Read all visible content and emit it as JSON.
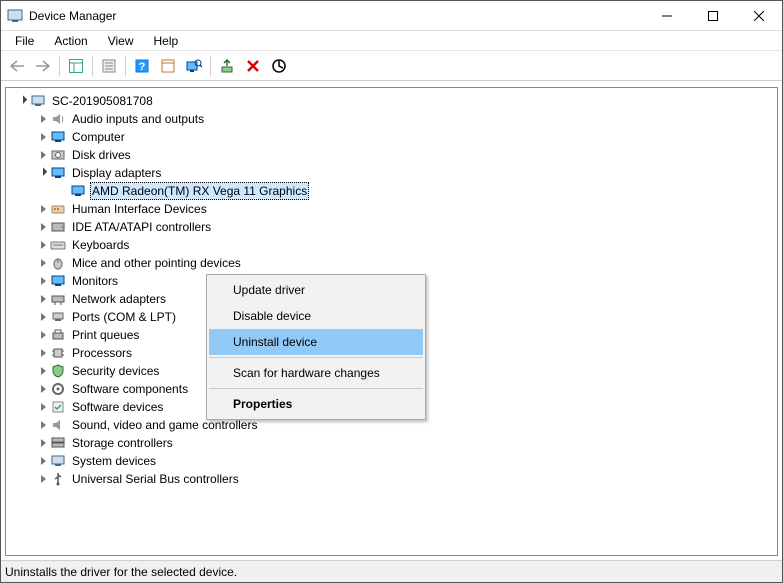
{
  "window": {
    "title": "Device Manager",
    "status": "Uninstalls the driver for the selected device."
  },
  "menu": {
    "file": "File",
    "action": "Action",
    "view": "View",
    "help": "Help"
  },
  "root": {
    "name": "SC-201905081708"
  },
  "categories": {
    "audio": "Audio inputs and outputs",
    "computer": "Computer",
    "disk": "Disk drives",
    "display": "Display adapters",
    "hid": "Human Interface Devices",
    "ide": "IDE ATA/ATAPI controllers",
    "keyboards": "Keyboards",
    "mice": "Mice and other pointing devices",
    "monitors": "Monitors",
    "network": "Network adapters",
    "ports": "Ports (COM & LPT)",
    "printq": "Print queues",
    "processors": "Processors",
    "security": "Security devices",
    "swcomp": "Software components",
    "swdev": "Software devices",
    "sound": "Sound, video and game controllers",
    "storage": "Storage controllers",
    "system": "System devices",
    "usb": "Universal Serial Bus controllers"
  },
  "selected_device": "AMD Radeon(TM) RX Vega 11 Graphics",
  "context_menu": {
    "update": "Update driver",
    "disable": "Disable device",
    "uninstall": "Uninstall device",
    "scan": "Scan for hardware changes",
    "properties": "Properties"
  }
}
